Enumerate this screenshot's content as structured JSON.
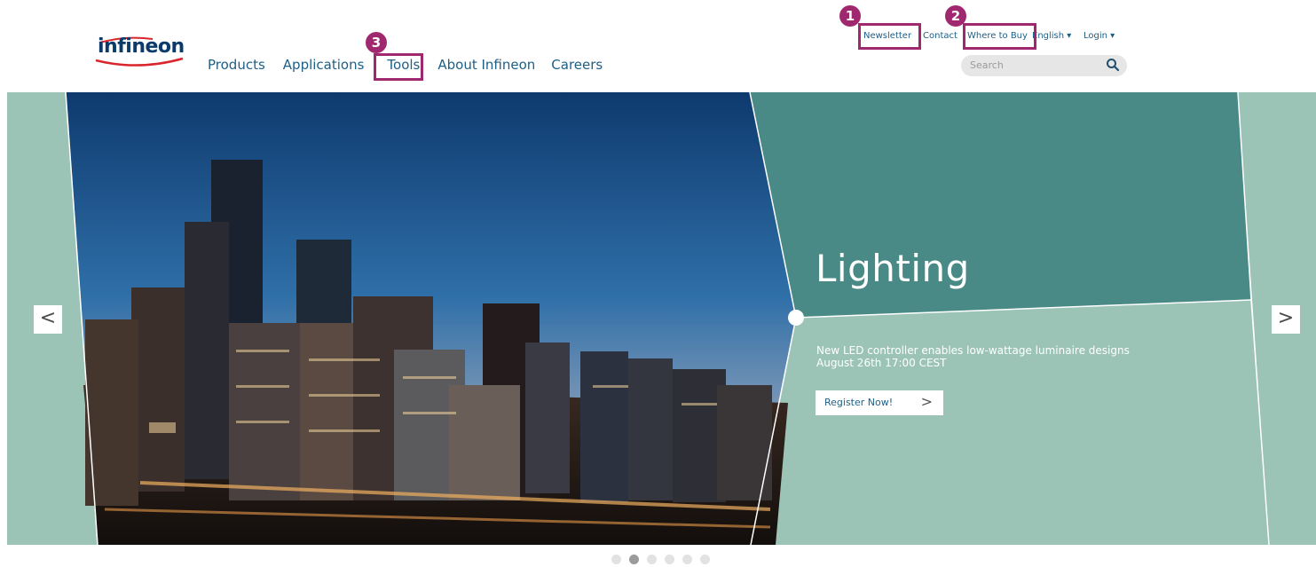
{
  "brand": {
    "logo_text": "infineon"
  },
  "main_nav": {
    "items": [
      "Products",
      "Applications",
      "Tools",
      "About Infineon",
      "Careers"
    ]
  },
  "utility_nav": {
    "newsletter": "Newsletter",
    "contact": "Contact",
    "where_to_buy": "Where to Buy",
    "language": "English ▾",
    "login": "Login ▾"
  },
  "search": {
    "placeholder": "Search"
  },
  "annotations": {
    "badge1": "1",
    "badge2": "2",
    "badge3": "3"
  },
  "hero": {
    "headline": "Lighting",
    "line1": "New LED controller enables low-wattage luminaire designs",
    "line2": "August 26th 17:00 CEST",
    "cta_label": "Register Now!",
    "cta_chevron": ">",
    "prev_label": "<",
    "next_label": ">"
  },
  "carousel": {
    "slide_count": 6,
    "active_index": 1
  },
  "colors": {
    "accent": "#a0286f",
    "panel_dark": "#4a8a86",
    "panel_light": "#9cc4b6",
    "link": "#1e5f86"
  },
  "icons": {
    "search": "search-icon",
    "prev": "chevron-left-icon",
    "next": "chevron-right-icon"
  }
}
